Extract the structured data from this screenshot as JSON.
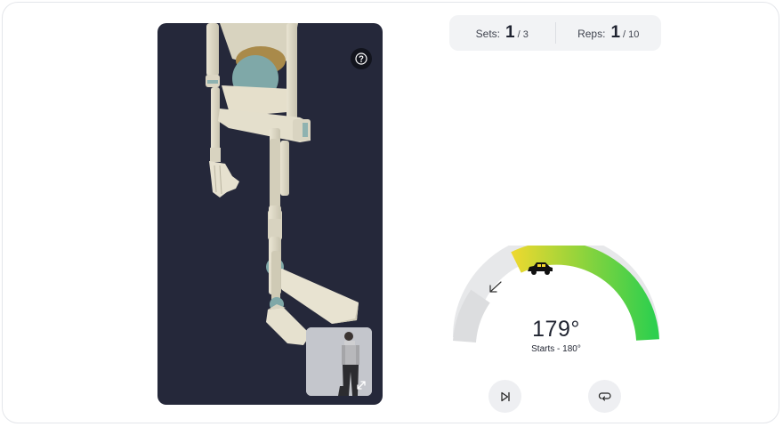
{
  "counters": {
    "sets_label": "Sets:",
    "sets_current": "1",
    "sets_total": "/ 3",
    "reps_label": "Reps:",
    "reps_current": "1",
    "reps_total": "/ 10"
  },
  "gauge": {
    "angle_value": "179°",
    "start_text": "Starts - 180°",
    "target_icon": "car-icon",
    "direction_icon": "arrow-down-left-icon",
    "colors": {
      "inactive": "#e3e4e6",
      "yellow": "#f5d92e",
      "green": "#2ecf4e"
    }
  },
  "viewport": {
    "background": "#25283a",
    "help_icon": "question-circle-icon",
    "pip_icon": "expand-icon"
  },
  "controls": {
    "skip_icon": "skip-forward-icon",
    "repeat_icon": "repeat-icon"
  }
}
